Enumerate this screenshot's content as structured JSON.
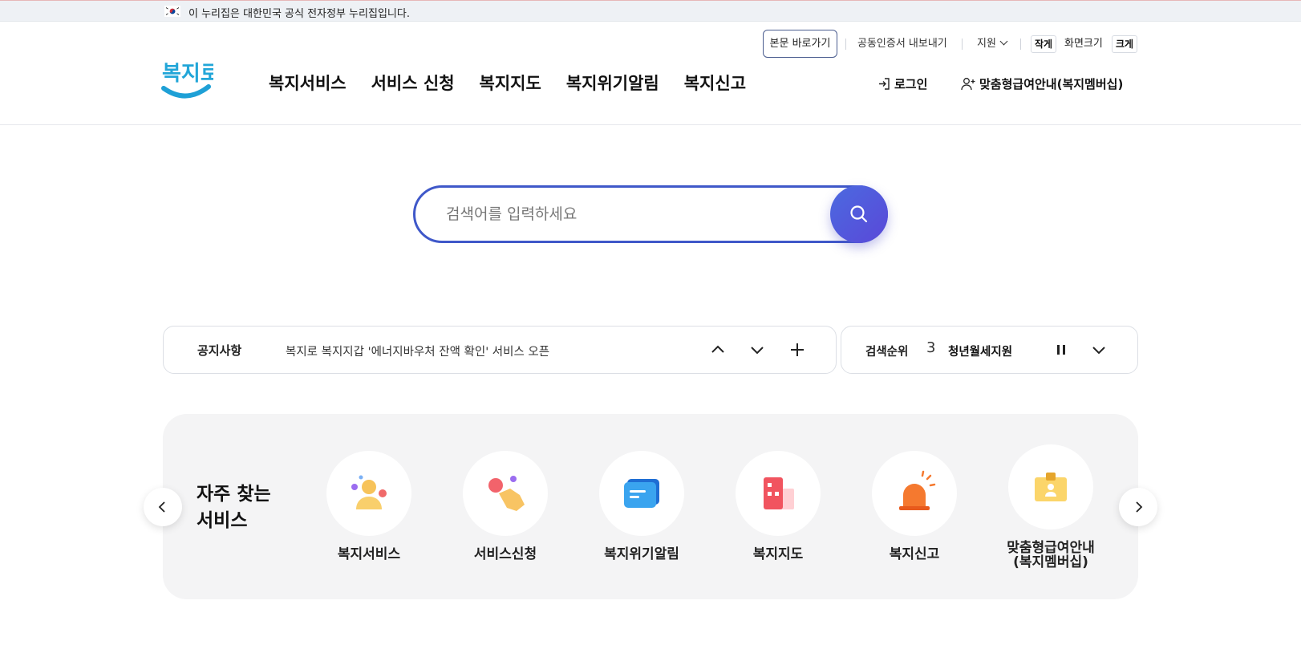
{
  "gov_banner": {
    "text": "이 누리집은 대한민국 공식 전자정부 누리집입니다."
  },
  "utility": {
    "skip_link": "본문 바로가기",
    "cert_export": "공동인증서 내보내기",
    "support": "지원",
    "size_small": "작게",
    "size_label": "화면크기",
    "size_large": "크게"
  },
  "logo": {
    "text": "복지로"
  },
  "nav": {
    "items": [
      "복지서비스",
      "서비스 신청",
      "복지지도",
      "복지위기알림",
      "복지신고"
    ],
    "login": "로그인",
    "membership": "맞춤형급여안내(복지멤버십)"
  },
  "search": {
    "placeholder": "검색어를 입력하세요"
  },
  "notice": {
    "label": "공지사항",
    "text": "복지로 복지지갑 '에너지바우처 잔액 확인' 서비스 오픈"
  },
  "search_rank": {
    "label": "검색순위",
    "rank": "3",
    "keyword": "청년월세지원"
  },
  "favorites": {
    "title_line1": "자주 찾는",
    "title_line2": "서비스",
    "items": [
      {
        "label": "복지서비스",
        "icon": "welfare-person-icon"
      },
      {
        "label": "서비스신청",
        "icon": "apply-hand-icon"
      },
      {
        "label": "복지위기알림",
        "icon": "crisis-message-icon"
      },
      {
        "label": "복지지도",
        "icon": "map-building-icon"
      },
      {
        "label": "복지신고",
        "icon": "siren-icon"
      },
      {
        "label": "맞춤형급여안내",
        "label2": "(복지멤버십)",
        "icon": "membership-id-icon"
      }
    ]
  },
  "colors": {
    "primary": "#3f58c9",
    "accent_gradient_end": "#5a48d8",
    "logo_cyan": "#22a6d8"
  }
}
